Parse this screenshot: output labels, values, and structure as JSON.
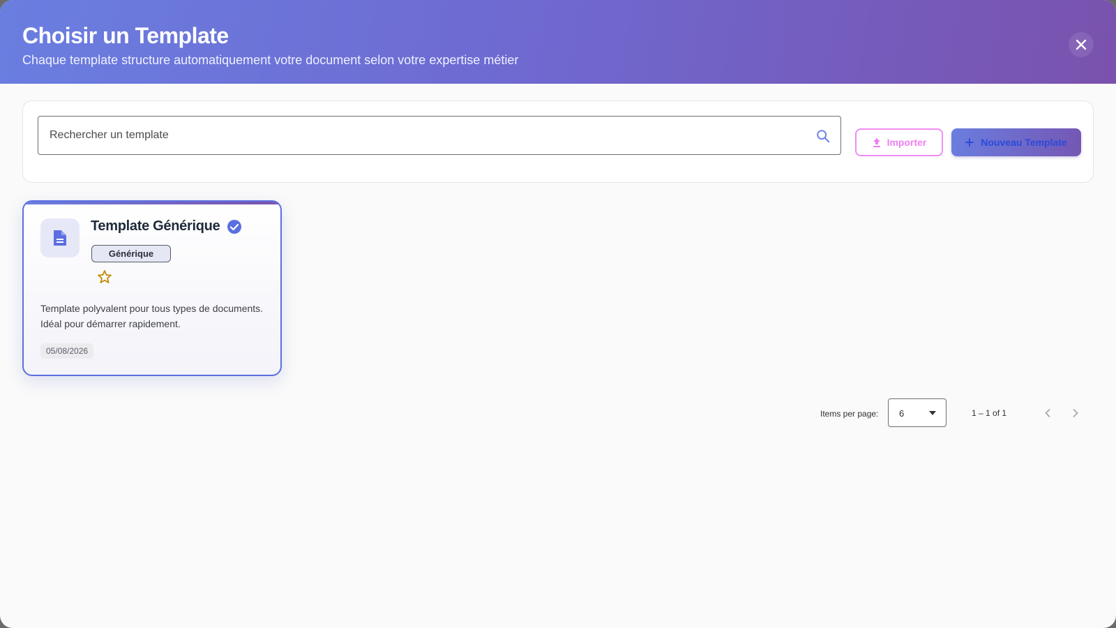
{
  "header": {
    "title": "Choisir un Template",
    "subtitle": "Chaque template structure automatiquement votre document selon votre expertise métier",
    "close_icon": "close-icon"
  },
  "toolbar": {
    "search_placeholder": "Rechercher un template",
    "search_value": "",
    "search_icon": "search-icon",
    "import_label": "Importer",
    "import_icon": "upload-icon",
    "new_label": "Nouveau Template",
    "new_icon": "plus-icon"
  },
  "templates": [
    {
      "title": "Template Générique",
      "verified": true,
      "category": "Générique",
      "favorite": false,
      "description": "Template polyvalent pour tous types de documents. Idéal pour démarrer rapidement.",
      "date": "05/08/2026",
      "icon": "document-icon"
    }
  ],
  "paginator": {
    "items_per_page_label": "Items per page:",
    "items_per_page_value": "6",
    "range_label": "1 – 1 of 1"
  },
  "colors": {
    "header_gradient_start": "#6a7ee0",
    "header_gradient_end": "#7a52ad",
    "accent": "#5b6fe0",
    "import_pink": "#f08cf4",
    "star_gold": "#c08a00"
  }
}
